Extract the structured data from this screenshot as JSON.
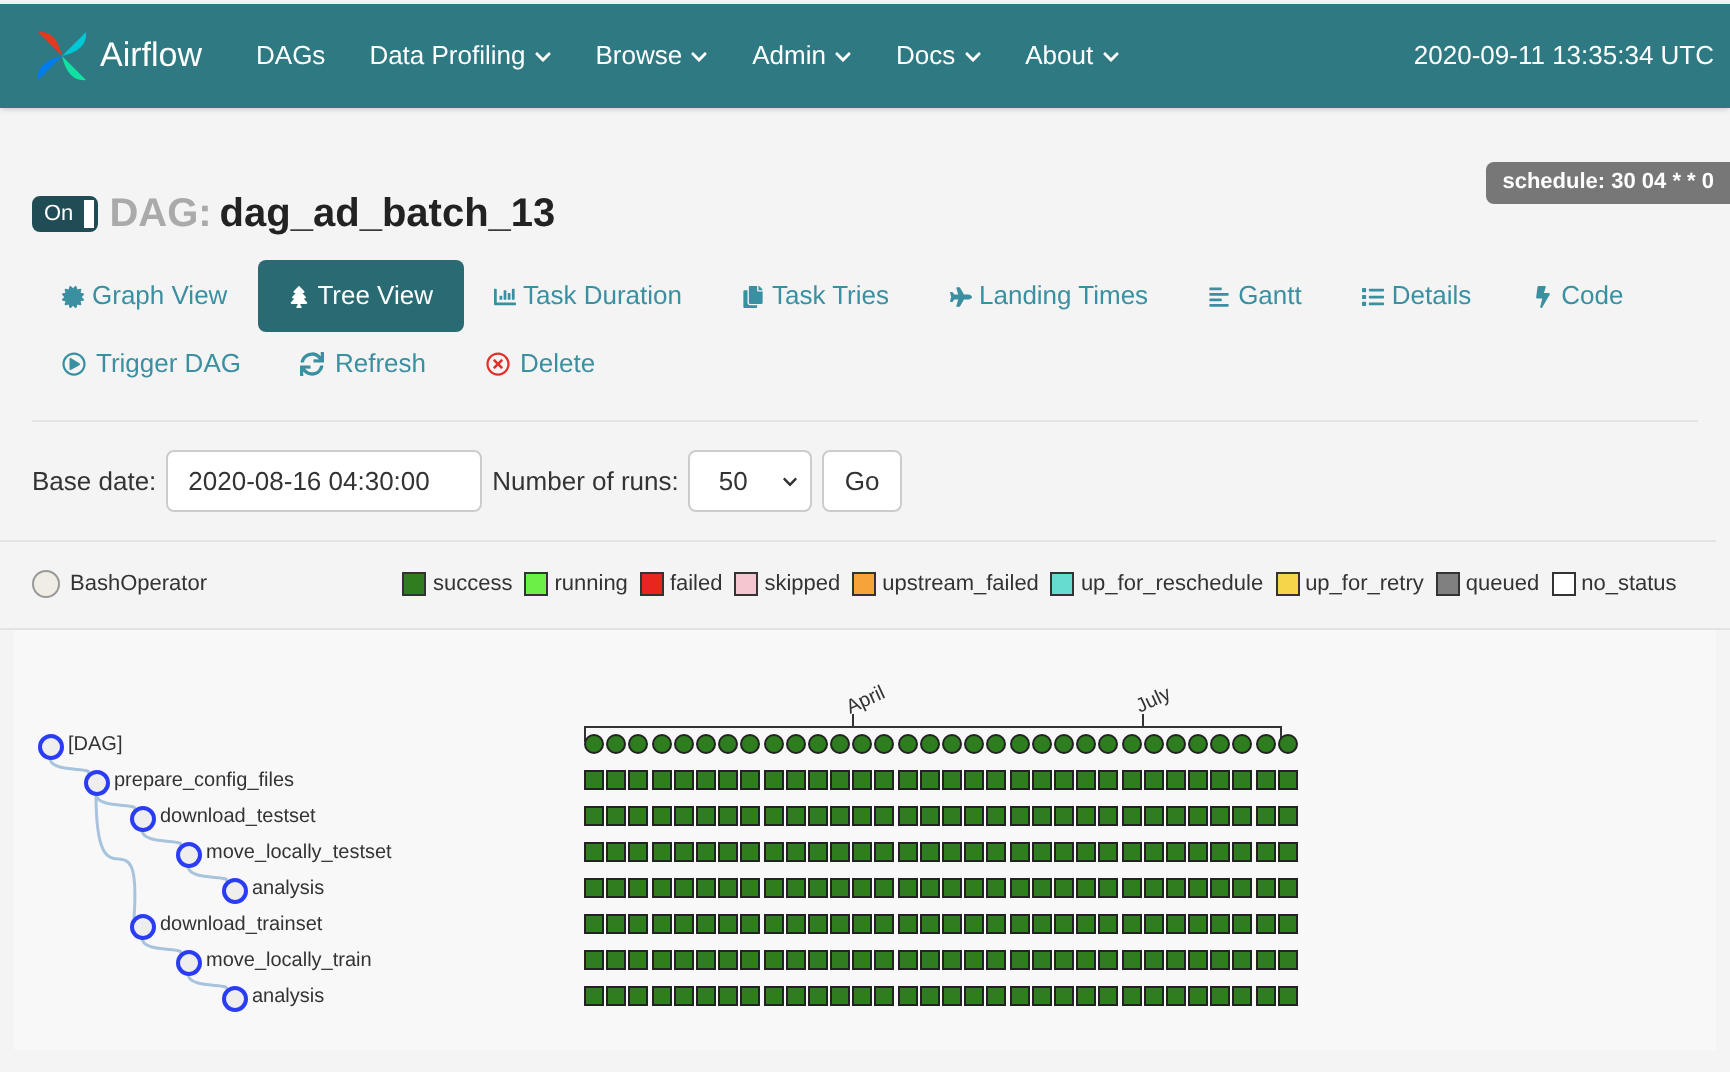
{
  "navbar": {
    "brand": "Airflow",
    "items": [
      {
        "label": "DAGs",
        "dropdown": false
      },
      {
        "label": "Data Profiling",
        "dropdown": true
      },
      {
        "label": "Browse",
        "dropdown": true
      },
      {
        "label": "Admin",
        "dropdown": true
      },
      {
        "label": "Docs",
        "dropdown": true
      },
      {
        "label": "About",
        "dropdown": true
      }
    ],
    "clock": "2020-09-11 13:35:34 UTC"
  },
  "dag": {
    "toggle": {
      "label": "On",
      "on": true
    },
    "prefix": "DAG:",
    "name": "dag_ad_batch_13",
    "schedule": "schedule: 30 04 * * 0"
  },
  "view_tabs": [
    {
      "label": "Graph View",
      "selected": false
    },
    {
      "label": "Tree View",
      "selected": true
    },
    {
      "label": "Task Duration",
      "selected": false
    },
    {
      "label": "Task Tries",
      "selected": false
    },
    {
      "label": "Landing Times",
      "selected": false
    },
    {
      "label": "Gantt",
      "selected": false
    },
    {
      "label": "Details",
      "selected": false
    },
    {
      "label": "Code",
      "selected": false
    }
  ],
  "actions": [
    {
      "label": "Trigger DAG",
      "kind": "normal"
    },
    {
      "label": "Refresh",
      "kind": "normal"
    },
    {
      "label": "Delete",
      "kind": "danger"
    }
  ],
  "form": {
    "base_date_label": "Base date:",
    "base_date": "2020-08-16 04:30:00",
    "runs_label": "Number of runs:",
    "runs": "50",
    "go": "Go"
  },
  "operators": [
    {
      "label": "BashOperator",
      "color": "#f0ede4"
    }
  ],
  "legend": [
    {
      "label": "success",
      "color": "#2e7d1f"
    },
    {
      "label": "running",
      "color": "#6cf048"
    },
    {
      "label": "failed",
      "color": "#e8261f"
    },
    {
      "label": "skipped",
      "color": "#f4c6cf"
    },
    {
      "label": "upstream_failed",
      "color": "#f5a43a"
    },
    {
      "label": "up_for_reschedule",
      "color": "#66dbcf"
    },
    {
      "label": "up_for_retry",
      "color": "#f7d54a"
    },
    {
      "label": "queued",
      "color": "#808080"
    },
    {
      "label": "no_status",
      "color": "#ffffff"
    }
  ],
  "timeline": {
    "labels": [
      "April",
      "July"
    ]
  },
  "tree": [
    {
      "label": "[DAG]",
      "kind": "dag",
      "color": "#2e7d1f",
      "children": [
        {
          "label": "prepare_config_files",
          "kind": "task",
          "color": "#2e7d1f",
          "children": [
            {
              "label": "download_testset",
              "kind": "task",
              "color": "#2e7d1f",
              "children": [
                {
                  "label": "move_locally_testset",
                  "kind": "task",
                  "color": "#2e7d1f",
                  "children": [
                    {
                      "label": "analysis",
                      "kind": "task",
                      "color": "#2e7d1f"
                    }
                  ]
                }
              ]
            },
            {
              "label": "download_trainset",
              "kind": "task",
              "color": "#2e7d1f",
              "children": [
                {
                  "label": "move_locally_train",
                  "kind": "task",
                  "color": "#2e7d1f",
                  "children": [
                    {
                      "label": "analysis",
                      "kind": "task",
                      "color": "#2e7d1f"
                    }
                  ]
                }
              ]
            }
          ]
        }
      ]
    }
  ]
}
